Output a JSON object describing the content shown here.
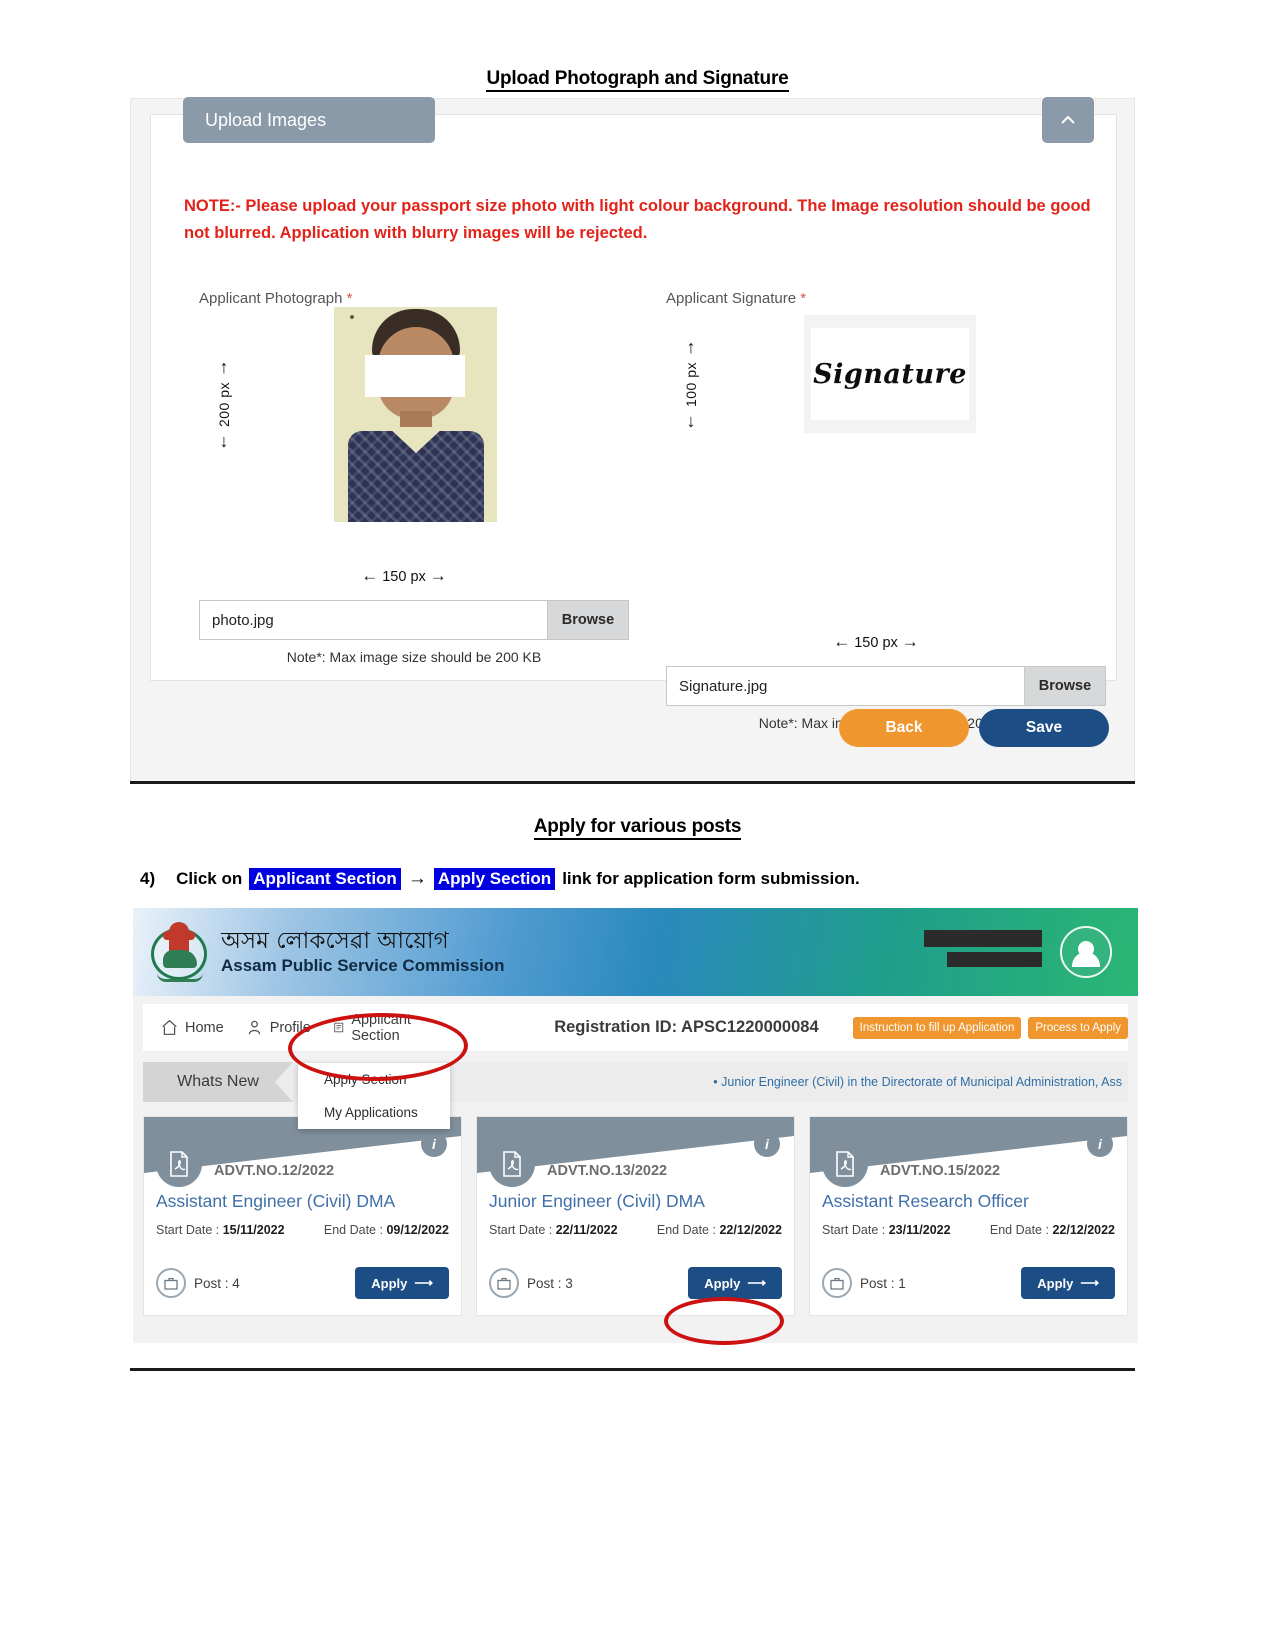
{
  "section1": {
    "heading": "Upload Photograph and Signature",
    "panel_title": "Upload Images",
    "collapse_icon": "chevron-up-icon",
    "note": "NOTE:- Please upload your passport size photo with light colour background. The Image resolution should be good not blurred. Application with blurry images will be rejected.",
    "photo": {
      "label": "Applicant Photograph",
      "required_mark": "*",
      "height_dim": "200 px",
      "width_dim": "150 px",
      "file_name": "photo.jpg",
      "browse_label": "Browse",
      "size_note": "Note*: Max image size should be 200 KB"
    },
    "signature": {
      "label": "Applicant Signature",
      "required_mark": "*",
      "height_dim": "100 px",
      "width_dim": "150 px",
      "sample_text": "Signature",
      "file_name": "Signature.jpg",
      "browse_label": "Browse",
      "size_note": "Note*: Max image size should be 200 KB"
    },
    "buttons": {
      "back": "Back",
      "save": "Save"
    },
    "colors": {
      "back": "#f0962e",
      "save": "#1c4d84",
      "note": "#e2231a",
      "panel_header": "#8a9aa8"
    }
  },
  "section2": {
    "heading": "Apply for various posts",
    "instruction": {
      "number": "4)",
      "before": "Click on",
      "highlight1": "Applicant Section",
      "arrow": "→",
      "highlight2": "Apply Section",
      "after": "link for application form submission.",
      "highlight_color": "#0000e0"
    },
    "portal": {
      "org_assamese": "অসম লোকসেৱা আয়োগ",
      "org_english": "Assam Public Service Commission",
      "emblem_icon": "assam-state-emblem-icon",
      "avatar_icon": "user-avatar-icon",
      "nav": [
        {
          "label": "Home",
          "icon": "home-icon"
        },
        {
          "label": "Profile",
          "icon": "user-icon"
        },
        {
          "label": "Applicant Section",
          "icon": "document-icon"
        }
      ],
      "dropdown": [
        {
          "label": "Apply Section"
        },
        {
          "label": "My Applications"
        }
      ],
      "registration_id_label": "Registration ID: APSC1220000084",
      "action_buttons": [
        "Instruction to fill up Application",
        "Process to Apply"
      ],
      "whats_new_label": "Whats New",
      "ticker_text": "Junior Engineer (Civil) in the Directorate of Municipal Administration, Ass",
      "ticker_bullet": "•",
      "cards": [
        {
          "advt": "ADVT.NO.12/2022",
          "title": "Assistant Engineer (Civil) DMA",
          "start_label": "Start Date :",
          "start_date": "15/11/2022",
          "end_label": "End Date :",
          "end_date": "09/12/2022",
          "post_label": "Post : 4",
          "apply_label": "Apply",
          "pdf_icon": "pdf-file-icon",
          "info_icon": "info-icon",
          "post_icon": "briefcase-icon"
        },
        {
          "advt": "ADVT.NO.13/2022",
          "title": "Junior Engineer (Civil) DMA",
          "start_label": "Start Date :",
          "start_date": "22/11/2022",
          "end_label": "End Date :",
          "end_date": "22/12/2022",
          "post_label": "Post : 3",
          "apply_label": "Apply",
          "pdf_icon": "pdf-file-icon",
          "info_icon": "info-icon",
          "post_icon": "briefcase-icon"
        },
        {
          "advt": "ADVT.NO.15/2022",
          "title": "Assistant Research Officer",
          "start_label": "Start Date :",
          "start_date": "23/11/2022",
          "end_label": "End Date :",
          "end_date": "22/12/2022",
          "post_label": "Post : 1",
          "apply_label": "Apply",
          "pdf_icon": "pdf-file-icon",
          "info_icon": "info-icon",
          "post_icon": "briefcase-icon"
        }
      ],
      "annotation_color": "#cc1111"
    }
  }
}
